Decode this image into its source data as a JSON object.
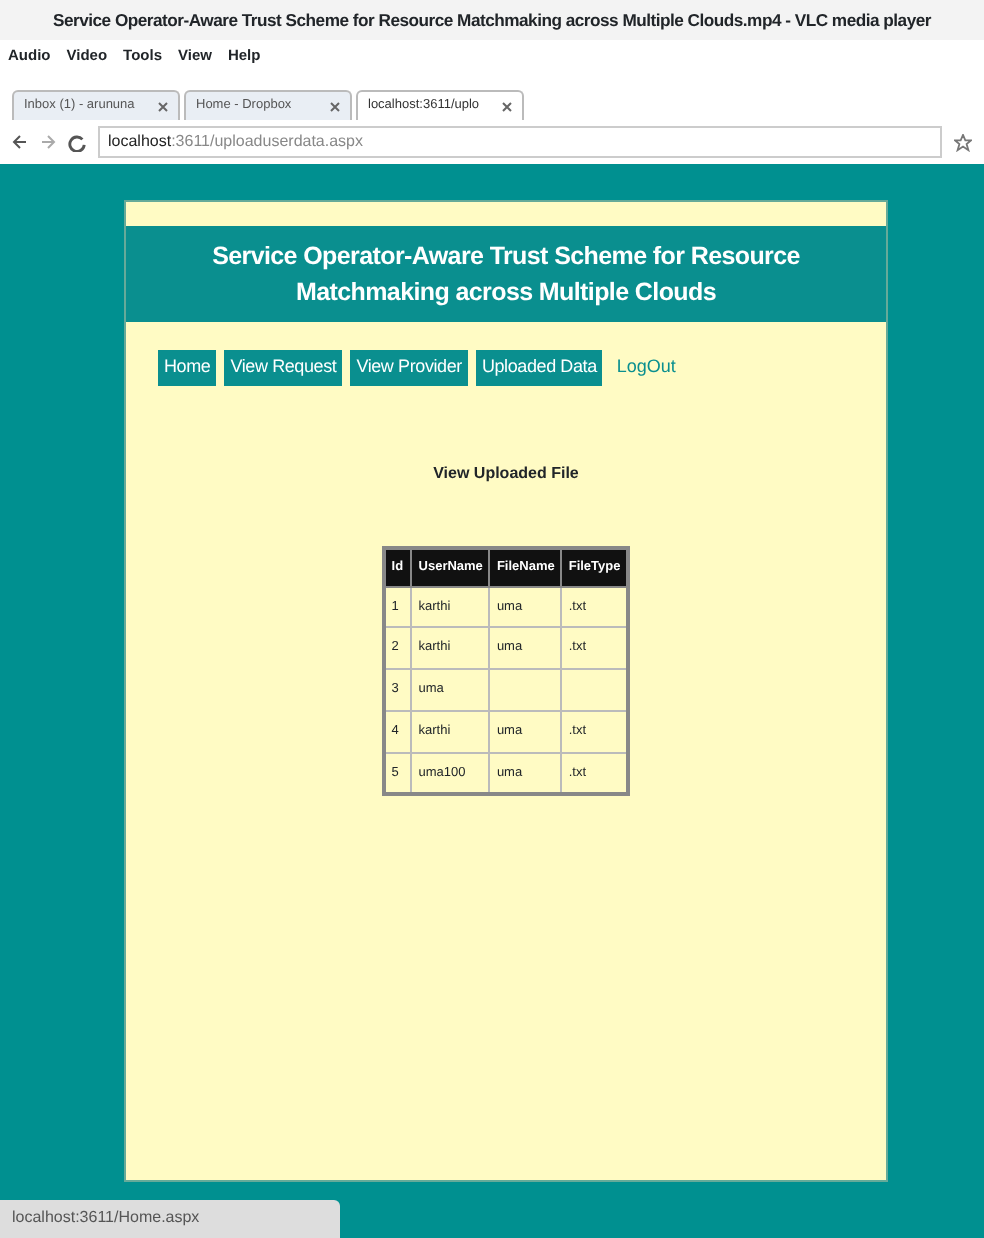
{
  "window": {
    "title": "Service Operator-Aware Trust Scheme for Resource Matchmaking across Multiple Clouds.mp4 - VLC media player"
  },
  "menu": [
    "Audio",
    "Video",
    "Tools",
    "View",
    "Help"
  ],
  "browser": {
    "tabs": [
      {
        "label": "Inbox (1) - arununa",
        "selected": false
      },
      {
        "label": "Home - Dropbox",
        "selected": false
      },
      {
        "label": "localhost:3611/uplo",
        "selected": true
      }
    ],
    "address": {
      "host": "localhost",
      "rest": ":3611/uploaduserdata.aspx"
    },
    "status_url": "localhost:3611/Home.aspx"
  },
  "page": {
    "title": "Service Operator-Aware Trust Scheme for Resource Matchmaking across Multiple Clouds",
    "nav": [
      {
        "label": "Home",
        "kind": "button"
      },
      {
        "label": "View Request",
        "kind": "button"
      },
      {
        "label": "View Provider",
        "kind": "button"
      },
      {
        "label": "Uploaded Data",
        "kind": "button"
      },
      {
        "label": "LogOut",
        "kind": "link"
      }
    ],
    "heading": "View Uploaded File",
    "table": {
      "columns": [
        "Id",
        "UserName",
        "FileName",
        "FileType"
      ],
      "rows": [
        [
          "1",
          "karthi",
          "uma",
          ".txt"
        ],
        [
          "2",
          "karthi",
          "uma",
          ".txt"
        ],
        [
          "3",
          "uma",
          "",
          ""
        ],
        [
          "4",
          "karthi",
          "uma",
          ".txt"
        ],
        [
          "5",
          "uma100",
          "uma",
          ".txt"
        ]
      ]
    }
  }
}
